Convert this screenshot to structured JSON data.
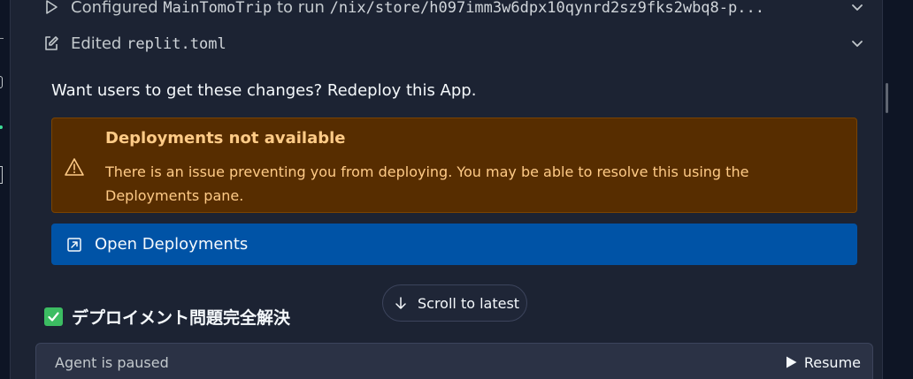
{
  "actions": [
    {
      "icon": "play-icon",
      "prefix": "Configured ",
      "code": "MainTomoTrip",
      "middle": " to run ",
      "code2": "/nix/store/h097imm3w6dpx10qynrd2sz9fks2wbq8-p..."
    },
    {
      "icon": "edit-icon",
      "prefix": "Edited ",
      "code": "replit.toml"
    }
  ],
  "redeploy_prompt": "Want users to get these changes? Redeploy this App.",
  "alert": {
    "title": "Deployments not available",
    "body": "There is an issue preventing you from deploying. You may be able to resolve this using the Deployments pane."
  },
  "open_deployments_label": "Open Deployments",
  "scroll_to_latest_label": "Scroll to latest",
  "heading": {
    "text": "デプロイメント問題完全解決"
  },
  "agent_status": {
    "label": "Agent is paused",
    "resume_label": "Resume"
  },
  "colors": {
    "background": "#1c2333",
    "alert_background": "#572d00",
    "alert_text": "#ffcb87",
    "primary_button": "#0053a6",
    "check_green": "#3cbd62"
  }
}
